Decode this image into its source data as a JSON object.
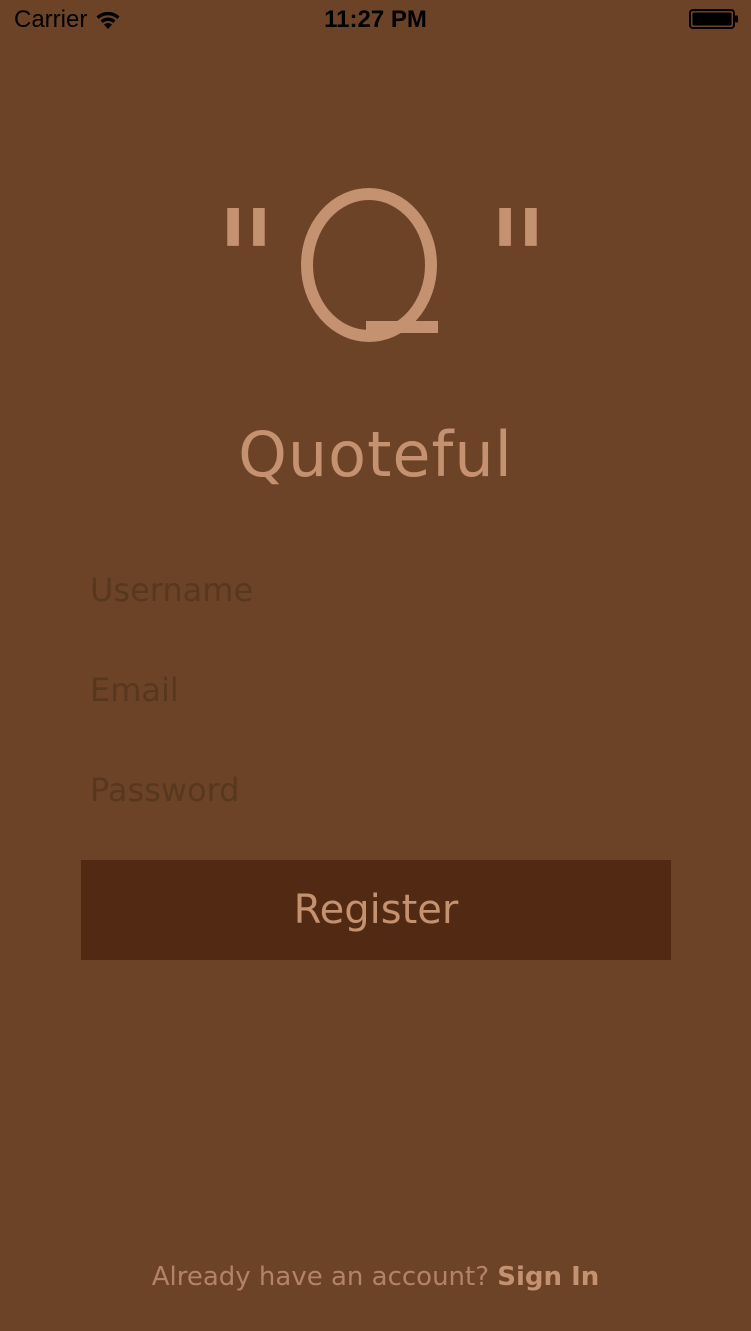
{
  "status_bar": {
    "carrier": "Carrier",
    "time": "11:27 PM"
  },
  "logo": {
    "open_quote": "\"",
    "letter": "Q",
    "close_quote": "\""
  },
  "app_name": "Quoteful",
  "form": {
    "username_placeholder": "Username",
    "email_placeholder": "Email",
    "password_placeholder": "Password",
    "register_label": "Register"
  },
  "footer": {
    "prompt": "Already have an account?",
    "signin_label": "Sign In"
  },
  "colors": {
    "background": "#6d4327",
    "accent": "#c49171",
    "button": "#522912"
  }
}
